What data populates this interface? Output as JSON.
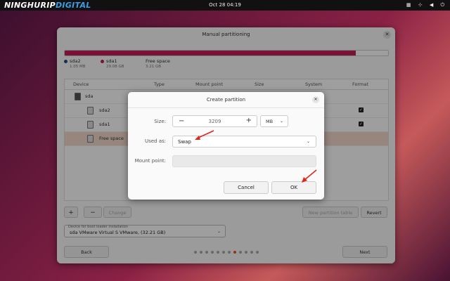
{
  "topbar": {
    "logo_part1": "NINGHURIP",
    "logo_part2": "DIGITAL",
    "clock": "Oct 28  04:19",
    "tray_icons": [
      "grid-icon",
      "network-icon",
      "volume-icon",
      "power-icon"
    ]
  },
  "window": {
    "title": "Manual partitioning",
    "close_glyph": "✕",
    "usage_bar": {
      "fill_fraction": 0.9,
      "fill_color": "#c01f5a"
    },
    "legend": [
      {
        "name": "sda2",
        "size": "1.05 MB",
        "color": "#1c4b8c"
      },
      {
        "name": "sda1",
        "size": "29.08 GB",
        "color": "#c01f5a"
      },
      {
        "name": "Free space",
        "size": "3.21 GB",
        "color": "#ffffff"
      }
    ],
    "table": {
      "headers": [
        "Device",
        "Type",
        "Mount point",
        "Size",
        "System",
        "Format"
      ],
      "rows": [
        {
          "name": "sda",
          "kind": "disk"
        },
        {
          "name": "sda2",
          "kind": "partition",
          "format": true
        },
        {
          "name": "sda1",
          "kind": "partition",
          "format": true
        },
        {
          "name": "Free space",
          "kind": "free",
          "selected": true
        }
      ]
    },
    "actions": {
      "add": "+",
      "remove": "−",
      "change": "Change",
      "new_table": "New partition table",
      "revert": "Revert"
    },
    "boot_device": {
      "label": "Device for boot loader installation",
      "value": "sda VMware Virtual S VMware, (32.21 GB)"
    },
    "nav": {
      "back": "Back",
      "next": "Next"
    },
    "pager": {
      "total": 12,
      "active_index": 7
    }
  },
  "dialog": {
    "title": "Create partition",
    "close_glyph": "✕",
    "size_label": "Size:",
    "size_value": "3209",
    "size_unit": "MB",
    "used_as_label": "Used as:",
    "used_as_value": "Swap",
    "mount_label": "Mount point:",
    "mount_value": "",
    "cancel": "Cancel",
    "ok": "OK"
  },
  "colors": {
    "accent": "#e95420",
    "annotation_arrow": "#e0261b"
  }
}
